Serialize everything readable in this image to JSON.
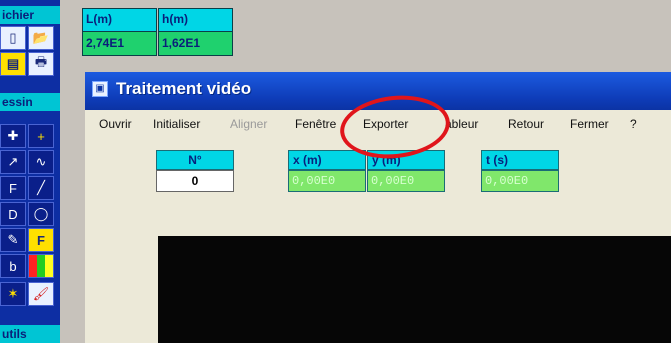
{
  "left_toolbar": {
    "labels": [
      "ichier",
      "essin",
      "utils"
    ],
    "buttons": [
      "file-icon",
      "folder-open-icon",
      "notebook-icon",
      "print-icon",
      "cross-y-icon",
      "plus-icon",
      "trend-icon",
      "wave-icon",
      "page-f-icon",
      "line-icon",
      "page-d-icon",
      "circle-icon",
      "pen-icon",
      "f-icon",
      "page-b-icon",
      "palette-icon",
      "sparkle-icon",
      "brush-icon"
    ]
  },
  "info_cells": [
    {
      "label": "L(m)",
      "value": "2,74E1"
    },
    {
      "label": "h(m)",
      "value": "1,62E1"
    }
  ],
  "window": {
    "title": "Traitement vidéo",
    "menu": [
      {
        "label": "Ouvrir",
        "enabled": true
      },
      {
        "label": "Initialiser",
        "enabled": true
      },
      {
        "label": "Aligner",
        "enabled": false
      },
      {
        "label": "Fenêtre",
        "enabled": true
      },
      {
        "label": "Exporter",
        "enabled": true
      },
      {
        "label": "ableur",
        "enabled": true
      },
      {
        "label": "Retour",
        "enabled": true
      },
      {
        "label": "Fermer",
        "enabled": true
      },
      {
        "label": "?",
        "enabled": true
      }
    ],
    "fields": {
      "n": {
        "label": "N°",
        "value": "0"
      },
      "x": {
        "label": "x (m)",
        "value": "0,00E0"
      },
      "y": {
        "label": "y (m)",
        "value": "0,00E0"
      },
      "t": {
        "label": "t (s)",
        "value": "0,00E0"
      }
    }
  },
  "colors": {
    "toolbar_blue": "#0d2ea3",
    "cyan": "#00d6e6",
    "green": "#1fd16e",
    "annotation_red": "#e0151b"
  }
}
